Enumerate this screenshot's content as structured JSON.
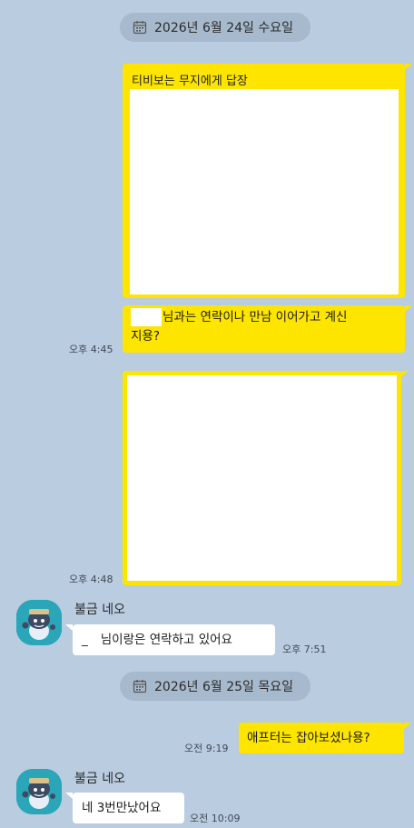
{
  "date_dividers": [
    {
      "label": "2026년 6월 24일 수요일"
    },
    {
      "label": "2026년 6월 25일 목요일"
    }
  ],
  "messages": {
    "reply_box": {
      "title": "티비보는 무지에게 답장"
    },
    "msg1": {
      "text": "님과는 연락이나 만남 이어가고 계신지용?",
      "line1": "님과는 연락이나 만남 이어가고 계신",
      "line2": "지용?",
      "time": "오후 4:45"
    },
    "msg2": {
      "time": "오후 4:48"
    },
    "msg3": {
      "sender": "불금 네오",
      "prefix": "_",
      "text": "님이랑은 연락하고 있어요",
      "time": "오후 7:51"
    },
    "msg4": {
      "text": "애프터는 잡아보셨나용?",
      "time": "오전 9:19"
    },
    "msg5": {
      "sender": "불금 네오",
      "text": "네 3번만났어요",
      "time": "오전 10:09"
    }
  },
  "icons": {
    "calendar": "calendar-icon",
    "avatar": "neo-avatar"
  },
  "colors": {
    "background": "#b9cce0",
    "my_bubble": "#fee500",
    "their_bubble": "#ffffff",
    "date_pill": "#a7b9cd",
    "avatar_bg": "#2aa6b8"
  }
}
